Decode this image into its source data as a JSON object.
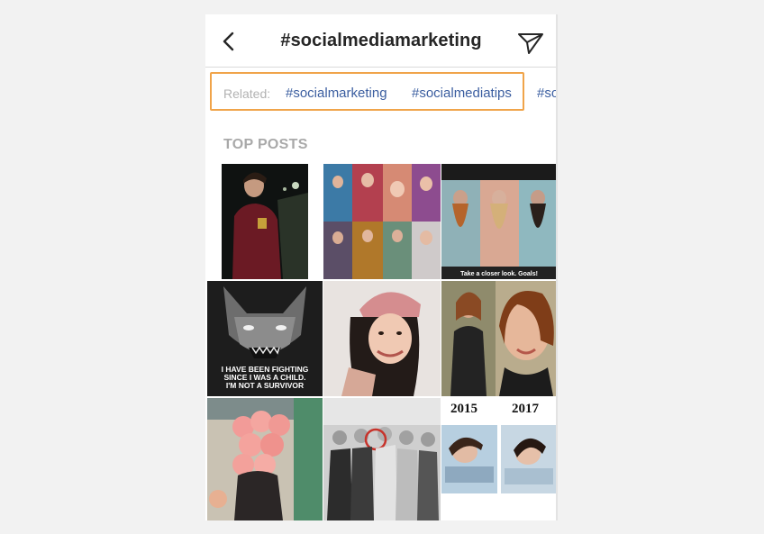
{
  "header": {
    "title": "#socialmediamarketing",
    "back_icon": "chevron-left-icon",
    "send_icon": "paper-plane-icon"
  },
  "related": {
    "label": "Related:",
    "tags": [
      "#socialmarketing",
      "#socialmediatips",
      "#so"
    ]
  },
  "section": {
    "title": "TOP POSTS"
  },
  "posts": {
    "beard_caption": "Take a closer look. Goals!",
    "wolf_caption_1": "I HAVE BEEN FIGHTING",
    "wolf_caption_2": "SINCE I WAS A CHILD.",
    "wolf_caption_3": "I'M NOT A SURVIVOR",
    "year_left": "2015",
    "year_right": "2017"
  },
  "colors": {
    "highlight": "#f0a44a",
    "tag": "#3b5ea0",
    "section_title": "#a9a9a9"
  }
}
